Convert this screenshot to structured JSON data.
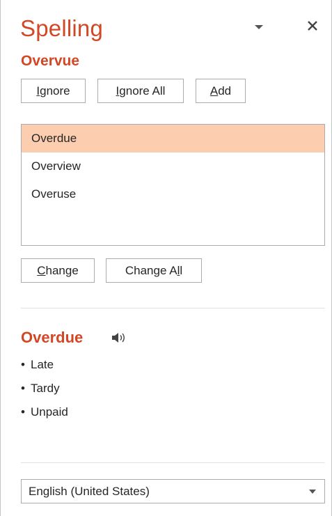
{
  "pane": {
    "title": "Spelling",
    "menu_icon": "chevron-down-icon",
    "close_icon": "close-icon"
  },
  "misspelled_word": "Overvue",
  "actions": {
    "ignore": {
      "pre": "",
      "key": "I",
      "post": "gnore"
    },
    "ignore_all": {
      "pre": "",
      "key": "I",
      "post": "gnore All"
    },
    "add": {
      "pre": "",
      "key": "A",
      "post": "dd"
    }
  },
  "suggestions": {
    "items": [
      "Overdue",
      "Overview",
      "Overuse"
    ],
    "selected": "Overdue"
  },
  "change_actions": {
    "change": {
      "pre": "",
      "key": "C",
      "post": "hange"
    },
    "change_all": {
      "pre": "Change A",
      "key": "l",
      "post": "l"
    }
  },
  "definition": {
    "word": "Overdue",
    "speaker_icon": "speaker-icon",
    "synonyms": [
      "Late",
      "Tardy",
      "Unpaid"
    ],
    "bullet": "•"
  },
  "language": {
    "selected": "English (United States)"
  },
  "colors": {
    "accent": "#d24726",
    "selection": "#fcceaf",
    "border": "#ababab"
  }
}
